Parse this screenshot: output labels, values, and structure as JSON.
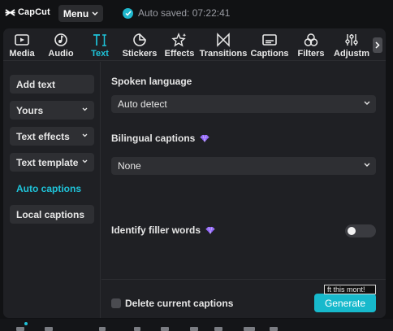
{
  "app": {
    "logo_text": "CapCut",
    "menu_label": "Menu",
    "auto_saved_text": "Auto saved: 07:22:41",
    "accent_color": "#1fc3d9"
  },
  "tabs": [
    {
      "label": "Media",
      "icon": "media-icon"
    },
    {
      "label": "Audio",
      "icon": "audio-icon"
    },
    {
      "label": "Text",
      "icon": "text-icon",
      "active": true
    },
    {
      "label": "Stickers",
      "icon": "stickers-icon"
    },
    {
      "label": "Effects",
      "icon": "effects-icon"
    },
    {
      "label": "Transitions",
      "icon": "transitions-icon"
    },
    {
      "label": "Captions",
      "icon": "captions-icon"
    },
    {
      "label": "Filters",
      "icon": "filters-icon"
    },
    {
      "label": "Adjustm",
      "icon": "adjustment-icon"
    }
  ],
  "sidebar": {
    "items": [
      {
        "label": "Add text"
      },
      {
        "label": "Yours",
        "has_dropdown": true
      },
      {
        "label": "Text effects",
        "has_dropdown": true
      },
      {
        "label": "Text template",
        "has_dropdown": true
      },
      {
        "label": "Auto captions",
        "active": true
      },
      {
        "label": "Local captions"
      }
    ]
  },
  "auto_captions": {
    "spoken_language_label": "Spoken language",
    "spoken_language_value": "Auto detect",
    "bilingual_label": "Bilingual captions",
    "bilingual_value": "None",
    "filler_label": "Identify filler words",
    "filler_enabled": false,
    "premium_icon": "diamond-icon",
    "delete_label": "Delete current captions",
    "delete_checked": false,
    "generate_label": "Generate",
    "tooltip_text": "ft this mont!"
  }
}
